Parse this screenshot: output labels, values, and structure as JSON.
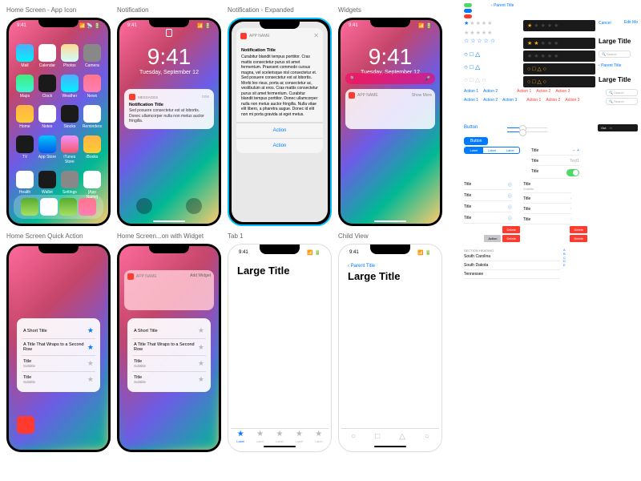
{
  "labels": {
    "home": "Home Screen - App Icon",
    "notif": "Notification",
    "notif_exp": "Notification - Expanded",
    "widgets": "Widgets",
    "quick": "Home Screen Quick Action",
    "quick_w": "Home Screen...on with Widget",
    "tab1": "Tab 1",
    "child": "Child View"
  },
  "status": {
    "time": "9:41"
  },
  "home_apps": [
    "Mail",
    "Calendar",
    "Photos",
    "Camera",
    "Maps",
    "Clock",
    "Weather",
    "News",
    "Home",
    "Notes",
    "Stocks",
    "Reminders",
    "TV",
    "App Store",
    "iTunes Store",
    "iBooks",
    "Health",
    "Wallet",
    "Settings",
    "[App Name]"
  ],
  "dock_apps": [
    "Phone",
    "Safari",
    "Messages",
    "Music"
  ],
  "lock": {
    "time": "9:41",
    "date": "Tuesday, September 12"
  },
  "notif": {
    "app": "MESSAGES",
    "when": "now",
    "title": "Notification Title",
    "body": "Sed posuere consectetur est at lobortis. Donec ullamcorper nulla non metus auctor fringilla."
  },
  "notif_exp": {
    "app": "APP NAME",
    "title": "Notification Title",
    "body": "Curabitur blandit tempus porttitor. Cras mattis consectetur purus sit amet fermentum. Praesent commodo cursus magna, vel scelerisque nisl consectetur et. Sed posuere consectetur est at lobortis. Morbi leo risus, porta ac consectetur ac, vestibulum at eros. Cras mattis consectetur purus sit amet fermentum. Curabitur blandit tempus porttitor. Donec ullamcorper nulla non metus auctor fringilla. Nulla vitae elit libero, a pharetra augue. Donec id elit non mi porta gravida at eget metus.",
    "action": "Action"
  },
  "widgets": {
    "app": "APP NAME",
    "more": "Show More"
  },
  "quick": {
    "items": [
      {
        "title": "A Short Title"
      },
      {
        "title": "A Title That Wraps to a Second Row"
      },
      {
        "title": "Title",
        "sub": "Subtitle"
      },
      {
        "title": "Title",
        "sub": "Subtitle"
      }
    ]
  },
  "quick_w": {
    "app": "APP NAME",
    "add": "Add Widget"
  },
  "tab_view": {
    "title": "Large Title",
    "tab_label": "Label"
  },
  "child_view": {
    "back": "Parent Title",
    "title": "Large Title"
  },
  "components": {
    "parent": "Parent Title",
    "large": "Large Title",
    "cancel": "Cancel",
    "edit": "Edit Mo",
    "search": "Search",
    "actions": [
      "Action 1",
      "Action 2",
      "Action 3"
    ],
    "button": "Button",
    "label": "Label",
    "title": "Title",
    "subtitle": "Subtitle",
    "text1": "Text1",
    "delete": "Delete",
    "section": "SECTION HEADING",
    "list_items": [
      "South Carolina",
      "South Dakota",
      "Tennessee"
    ],
    "index": [
      "A",
      "B",
      "C",
      "D",
      "E"
    ],
    "out": "Out",
    "in": "In"
  }
}
